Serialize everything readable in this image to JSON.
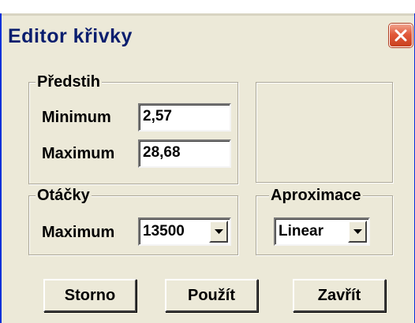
{
  "window": {
    "title": "Editor křivky"
  },
  "predstih": {
    "legend": "Předstih",
    "minimum_label": "Minimum",
    "minimum_value": "2,57",
    "maximum_label": "Maximum",
    "maximum_value": "28,68"
  },
  "otacky": {
    "legend": "Otáčky",
    "maximum_label": "Maximum",
    "maximum_value": "13500"
  },
  "aproximace": {
    "legend": "Aproximace",
    "value": "Linear"
  },
  "buttons": {
    "storno": "Storno",
    "pouzit": "Použít",
    "zavrit": "Zavřít"
  },
  "icons": {
    "close": "close-x-icon",
    "dropdown": "triangle-down-icon"
  },
  "colors": {
    "dialog_background": "#ece9d8",
    "title_text": "#0a1e6e",
    "close_button": "#e2593a",
    "window_border": "#0831d9"
  }
}
